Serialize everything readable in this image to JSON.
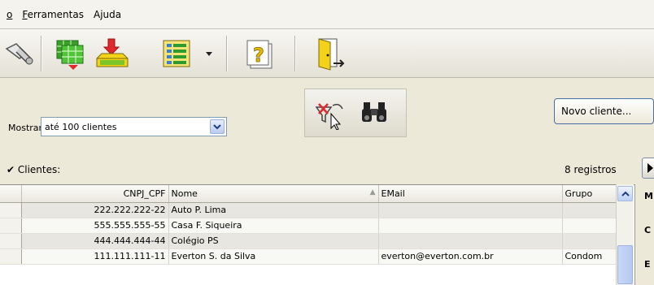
{
  "menu": {
    "items": [
      {
        "prefix": "",
        "underlined": "o",
        "rest": ""
      },
      {
        "prefix": "",
        "underlined": "F",
        "rest": "erramentas"
      },
      {
        "prefix": "",
        "underlined": "",
        "rest": "Ajuda"
      }
    ]
  },
  "toolbar": {
    "icons": [
      "tools-icon",
      "grid-export-icon",
      "import-icon",
      "report-icon",
      "dropdown-arrow-icon",
      "help-icon",
      "exit-door-icon"
    ]
  },
  "filter": {
    "mostrar_label": "Mostrar:",
    "select_value": "até 100 clientes",
    "novo_cliente_label": "Novo cliente..."
  },
  "list": {
    "clientes_label": "✔ Clientes:",
    "registros": "8 registros"
  },
  "grid": {
    "columns": [
      "CNPJ_CPF",
      "Nome",
      "EMail",
      "Grupo"
    ],
    "rows": [
      {
        "cnpj": "222.222.222-22",
        "nome": "Auto P. Lima",
        "email": "",
        "grupo": ""
      },
      {
        "cnpj": "555.555.555-55",
        "nome": "Casa F. Siqueira",
        "email": "",
        "grupo": ""
      },
      {
        "cnpj": "444.444.444-44",
        "nome": "Colégio PS",
        "email": "",
        "grupo": ""
      },
      {
        "cnpj": "111.111.111-11",
        "nome": "Everton S. da Silva",
        "email": "everton@everton.com.br",
        "grupo": "Condom"
      }
    ]
  },
  "side_panel": {
    "letters": [
      "M",
      "C",
      "E"
    ]
  },
  "colors": {
    "background": "#ece9d8",
    "row_odd": "#e8e6e1",
    "row_even": "#f8f8f5",
    "button_border": "#4a6da8"
  }
}
